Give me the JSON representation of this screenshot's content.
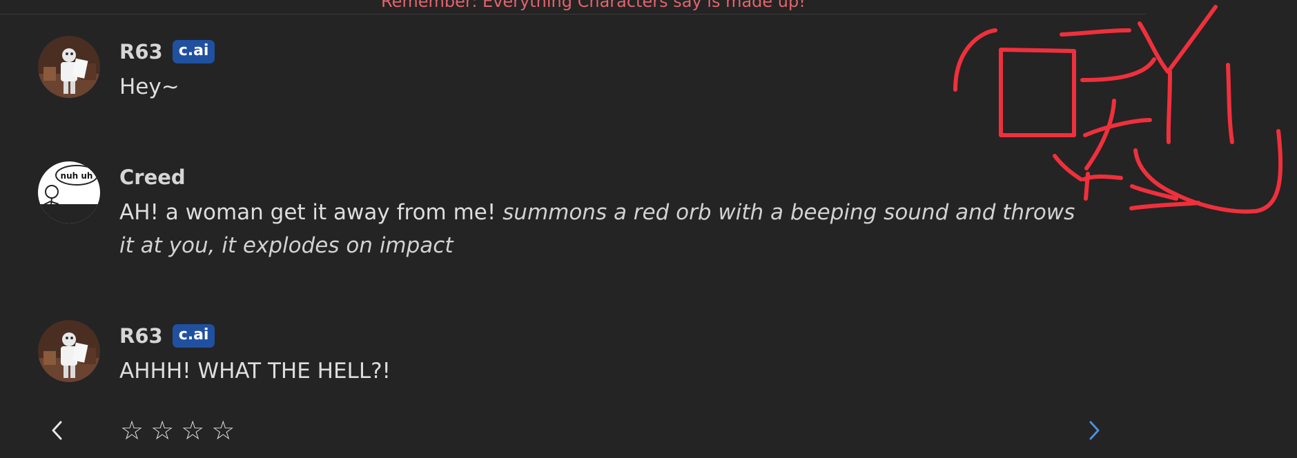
{
  "disclaimer": "Remember: Everything Characters say is made up!",
  "messages": [
    {
      "author": "R63",
      "badge": "c.ai",
      "text": "Hey~",
      "avatar_icon": "robot-character-avatar"
    },
    {
      "author": "Creed",
      "text_plain": "AH! a woman get it away from me! ",
      "text_action": "summons a red orb with a beeping sound and throws it at you, it explodes on impact",
      "avatar_icon": "nuh-uh-meme-avatar",
      "avatar_text": "nuh uh"
    },
    {
      "author": "R63",
      "badge": "c.ai",
      "text": "AHHH! WHAT THE HELL?!",
      "avatar_icon": "robot-character-avatar"
    }
  ],
  "rating": {
    "star_glyph": "☆",
    "stars_filled": 0,
    "stars_total": 4
  },
  "navigation": {
    "prev_icon": "chevron-left-icon",
    "next_icon": "chevron-right-icon"
  },
  "colors": {
    "background": "#242424",
    "disclaimer": "#e4636d",
    "badge": "#2050a0",
    "next_arrow": "#4a90e2",
    "scribble": "#f0303c"
  }
}
